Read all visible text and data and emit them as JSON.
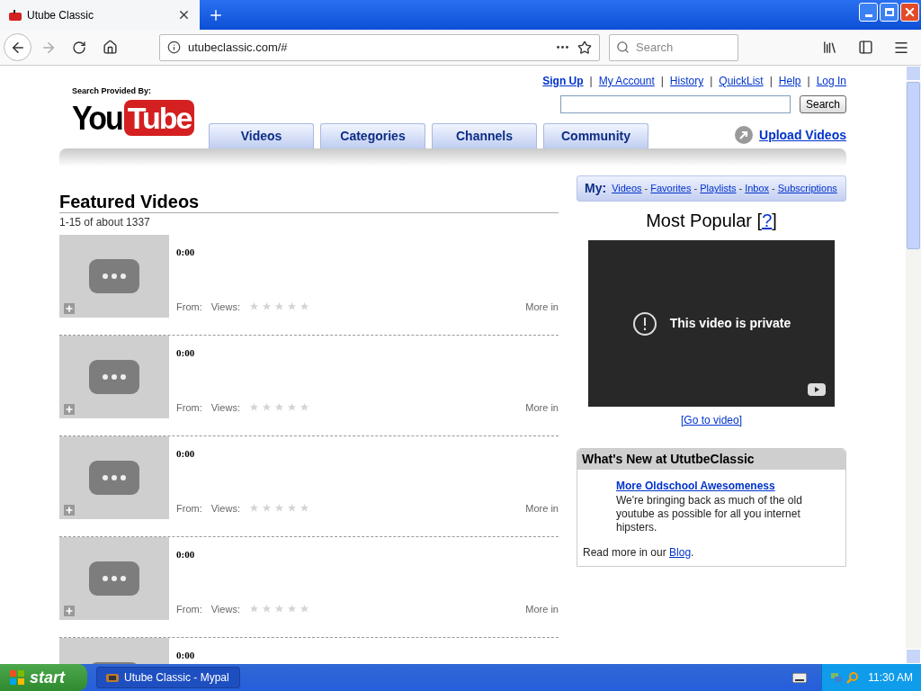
{
  "browser": {
    "tab_title": "Utube Classic",
    "url": "utubeclassic.com/#",
    "search_placeholder": "Search"
  },
  "header": {
    "provided_by": "Search Provided By:",
    "logo": {
      "left": "You",
      "right": "Tube"
    },
    "top_links": [
      "Sign Up",
      "My Account",
      "History",
      "QuickList",
      "Help",
      "Log In"
    ],
    "link_separator": "|",
    "search_button": "Search",
    "nav_tabs": [
      {
        "label": "Videos",
        "selected": false
      },
      {
        "label": "Categories",
        "selected": false
      },
      {
        "label": "Channels",
        "selected": false
      },
      {
        "label": "Community",
        "selected": false
      }
    ],
    "upload": "Upload Videos"
  },
  "featured": {
    "title": "Featured Videos",
    "count": "1-15 of about 1337",
    "videos": [
      {
        "duration": "0:00",
        "from": "From:",
        "views": "Views:",
        "stars": 0,
        "more": "More in"
      },
      {
        "duration": "0:00",
        "from": "From:",
        "views": "Views:",
        "stars": 0,
        "more": "More in"
      },
      {
        "duration": "0:00",
        "from": "From:",
        "views": "Views:",
        "stars": 0,
        "more": "More in"
      },
      {
        "duration": "0:00",
        "from": "From:",
        "views": "Views:",
        "stars": 0,
        "more": "More in"
      },
      {
        "duration": "0:00"
      }
    ]
  },
  "my_bar": {
    "label": "My:",
    "separator": "-",
    "links": [
      "Videos",
      "Favorites",
      "Playlists",
      "Inbox",
      "Subscriptions"
    ]
  },
  "most_popular": {
    "title": "Most Popular [",
    "help": "?",
    "close": "]",
    "player_message": "This video is private",
    "go_to_video": "[Go to video]"
  },
  "whats_new": {
    "title": "What's New at UtutbeClassic",
    "article_title": "More Oldschool Awesomeness",
    "article_body": "We're bringing back as much of the old youtube as possible for all you internet hipsters.",
    "read_more": "Read more in our ",
    "blog": "Blog",
    "after": "."
  },
  "taskbar": {
    "start": "start",
    "task": "Utube Classic - Mypal",
    "clock": "11:30 AM"
  }
}
